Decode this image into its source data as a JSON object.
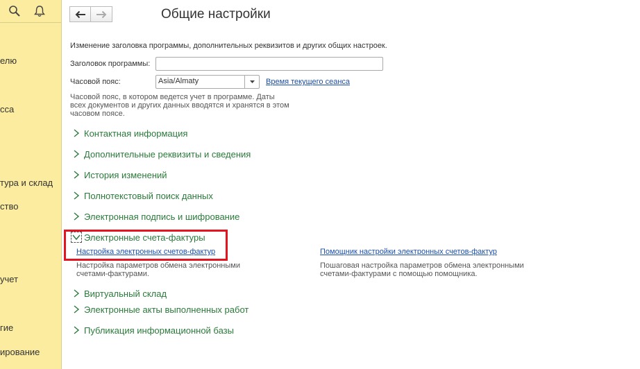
{
  "sidebar": {
    "items": [
      {
        "label": "елю"
      },
      {
        "label": "сса"
      },
      {
        "label": "тура и склад"
      },
      {
        "label": "ство"
      },
      {
        "label": "учет"
      },
      {
        "label": "гие"
      },
      {
        "label": "ирование"
      }
    ]
  },
  "header": {
    "title": "Общие настройки"
  },
  "main": {
    "description": "Изменение заголовка программы, дополнительных реквизитов и других общих настроек.",
    "app_title_label": "Заголовок программы:",
    "app_title_value": "",
    "timezone_label": "Часовой пояс:",
    "timezone_value": "Asia/Almaty",
    "session_time_link": "Время текущего сеанса",
    "timezone_hint": "Часовой пояс, в котором ведется учет в программе. Даты всех документов и других данных вводятся и хранятся в этом часовом поясе.",
    "groups_before": [
      {
        "title": "Контактная информация"
      },
      {
        "title": "Дополнительные реквизиты и сведения"
      },
      {
        "title": "История изменений"
      },
      {
        "title": "Полнотекстовый поиск данных"
      },
      {
        "title": "Электронная подпись и шифрование"
      }
    ],
    "expanded_group": {
      "title": "Электронные счета-фактуры",
      "left_link": "Настройка электронных счетов-фактур",
      "left_hint": "Настройка параметров обмена электронными счетами-фактурами.",
      "right_link": "Помощник настройки электронных счетов-фактур",
      "right_hint": "Пошаговая настройка параметров обмена электронными счетами-фактурами с помощью помощника."
    },
    "groups_after": [
      {
        "title": "Виртуальный склад"
      },
      {
        "title": "Электронные акты выполненных работ"
      },
      {
        "title": "Публикация информационной базы"
      }
    ]
  },
  "colors": {
    "sidebar_bg": "#fbec9f",
    "group_title": "#2a7a3a",
    "link": "#1a4ea8",
    "highlight": "#e3131f"
  },
  "icons": [
    "search-icon",
    "bell-icon",
    "back-arrow-icon",
    "forward-arrow-icon",
    "dropdown-arrow-icon",
    "chevron-right-icon",
    "chevron-down-icon"
  ]
}
